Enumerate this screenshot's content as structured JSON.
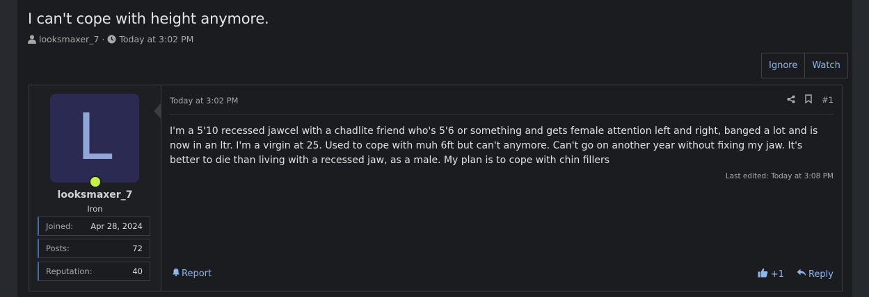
{
  "thread": {
    "title": "I can't cope with height anymore.",
    "author": "looksmaxer_7",
    "separator": "·",
    "date": "Today at 3:02 PM"
  },
  "buttons": {
    "ignore": "Ignore",
    "watch": "Watch"
  },
  "user": {
    "avatar_letter": "L",
    "username": "looksmaxer_7",
    "title": "Iron",
    "stats": [
      {
        "label": "Joined:",
        "value": "Apr 28, 2024"
      },
      {
        "label": "Posts:",
        "value": "72"
      },
      {
        "label": "Reputation:",
        "value": "40"
      }
    ]
  },
  "post": {
    "date": "Today at 3:02 PM",
    "number": "#1",
    "body": "I'm a 5'10 recessed jawcel with a chadlite friend who's 5'6 or something and gets female attention left and right, banged a lot and is now in an ltr. I'm a virgin at 25. Used to cope with muh 6ft but can't anymore. Can't go on another year without fixing my jaw. It's better to die than living with a recessed jaw, as a male. My plan is to cope with chin fillers",
    "last_edited": "Last edited: Today at 3:08 PM",
    "report": "Report",
    "reaction_count": "+1",
    "reply": "Reply"
  },
  "icons": {
    "user": "user-icon",
    "clock": "clock-icon",
    "share": "share-icon",
    "bookmark": "bookmark-icon",
    "bell": "bell-icon",
    "like": "thumbs-up-icon",
    "reply": "reply-arrow-icon"
  },
  "colors": {
    "link": "#8fb6ea",
    "online": "#c4f04a",
    "avatar_bg": "#2a2a52"
  }
}
